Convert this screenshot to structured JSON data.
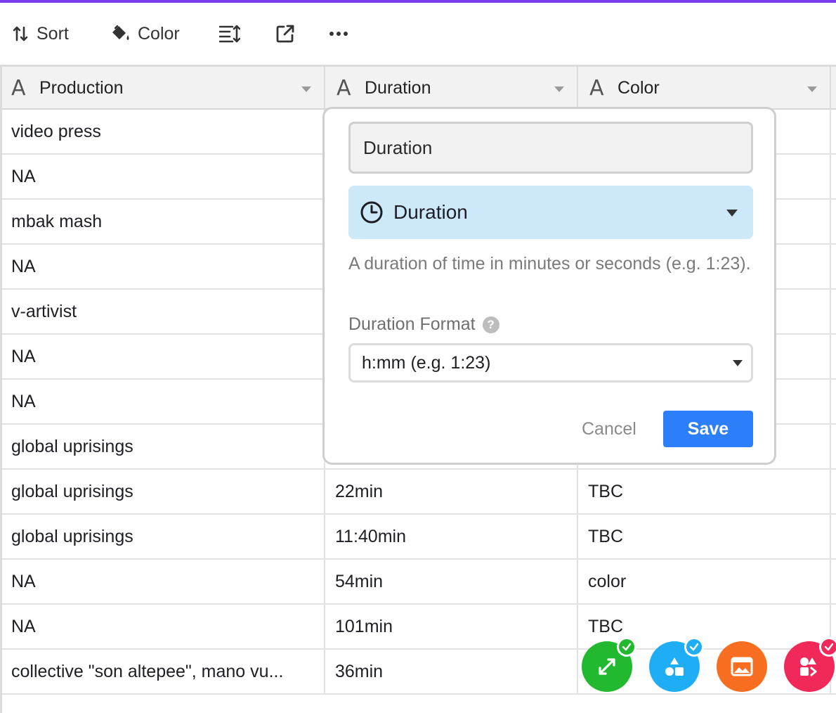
{
  "colors": {
    "accent": "#7c3aed",
    "save": "#2d7ff9",
    "type_bg": "#cde9f9"
  },
  "toolbar": {
    "sort_label": "Sort",
    "color_label": "Color",
    "icons": [
      "sort-icon",
      "paint-bucket-icon",
      "row-height-icon",
      "share-view-icon",
      "more-icon"
    ]
  },
  "columns": [
    {
      "label": "Production",
      "icon": "text-field-icon"
    },
    {
      "label": "Duration",
      "icon": "text-field-icon"
    },
    {
      "label": "Color",
      "icon": "text-field-icon"
    }
  ],
  "field_type_glyph": "A",
  "rows": [
    {
      "production": "video press",
      "duration": "",
      "color": ""
    },
    {
      "production": "NA",
      "duration": "",
      "color": ""
    },
    {
      "production": "mbak mash",
      "duration": "",
      "color": ""
    },
    {
      "production": "NA",
      "duration": "",
      "color": ""
    },
    {
      "production": "v-artivist",
      "duration": "",
      "color": ""
    },
    {
      "production": "NA",
      "duration": "",
      "color": ""
    },
    {
      "production": "NA",
      "duration": "",
      "color": ""
    },
    {
      "production": "global uprisings",
      "duration": "",
      "color": ""
    },
    {
      "production": "global uprisings",
      "duration": "22min",
      "color": "TBC"
    },
    {
      "production": "global uprisings",
      "duration": "11:40min",
      "color": "TBC"
    },
    {
      "production": "NA",
      "duration": "54min",
      "color": "color"
    },
    {
      "production": "NA",
      "duration": "101min",
      "color": "TBC"
    },
    {
      "production": "collective \"son altepee\", mano vu...",
      "duration": "36min",
      "color": ""
    }
  ],
  "popup": {
    "field_name": "Duration",
    "field_type": "Duration",
    "field_type_icon": "clock-icon",
    "description": "A duration of time in minutes or seconds (e.g. 1:23).",
    "format_label": "Duration Format",
    "format_help": "?",
    "format_value": "h:mm (e.g. 1:23)",
    "cancel_label": "Cancel",
    "save_label": "Save"
  },
  "fabs": [
    {
      "name": "expand-app-button",
      "icon": "expand-arrows-icon",
      "color": "#22b82f",
      "check_color": "#22b82f"
    },
    {
      "name": "shapes-app-button",
      "icon": "shapes-icon",
      "color": "#1faef5",
      "check_color": "#1faef5"
    },
    {
      "name": "image-app-button",
      "icon": "image-icon",
      "color": "#f76e20",
      "check_color": ""
    },
    {
      "name": "apps-app-button",
      "icon": "apps-icon",
      "color": "#f0295a",
      "check_color": "#f0295a"
    }
  ]
}
